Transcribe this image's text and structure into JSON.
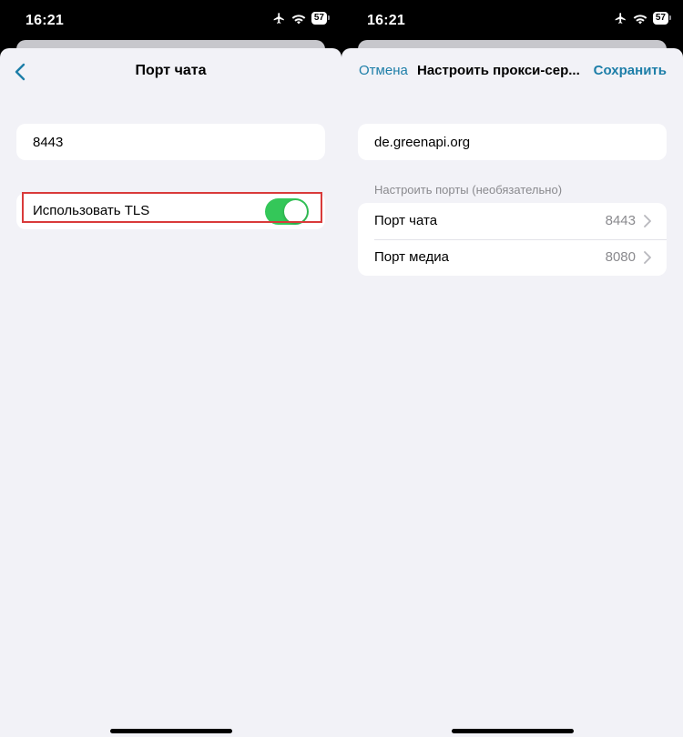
{
  "left": {
    "status": {
      "time": "16:21",
      "battery": "57"
    },
    "nav": {
      "title": "Порт чата"
    },
    "port_field": {
      "value": "8443"
    },
    "tls_row": {
      "label": "Использовать TLS",
      "enabled": true
    }
  },
  "right": {
    "status": {
      "time": "16:21",
      "battery": "57"
    },
    "nav": {
      "cancel": "Отмена",
      "title": "Настроить прокси-сер...",
      "save": "Сохранить"
    },
    "server_field": {
      "value": "de.greenapi.org"
    },
    "ports_section": {
      "header": "Настроить порты (необязательно)",
      "rows": [
        {
          "label": "Порт чата",
          "value": "8443"
        },
        {
          "label": "Порт медиа",
          "value": "8080"
        }
      ]
    }
  },
  "colors": {
    "accent": "#1d7ea8",
    "toggle_on": "#34c759",
    "highlight": "#d93a3a"
  }
}
